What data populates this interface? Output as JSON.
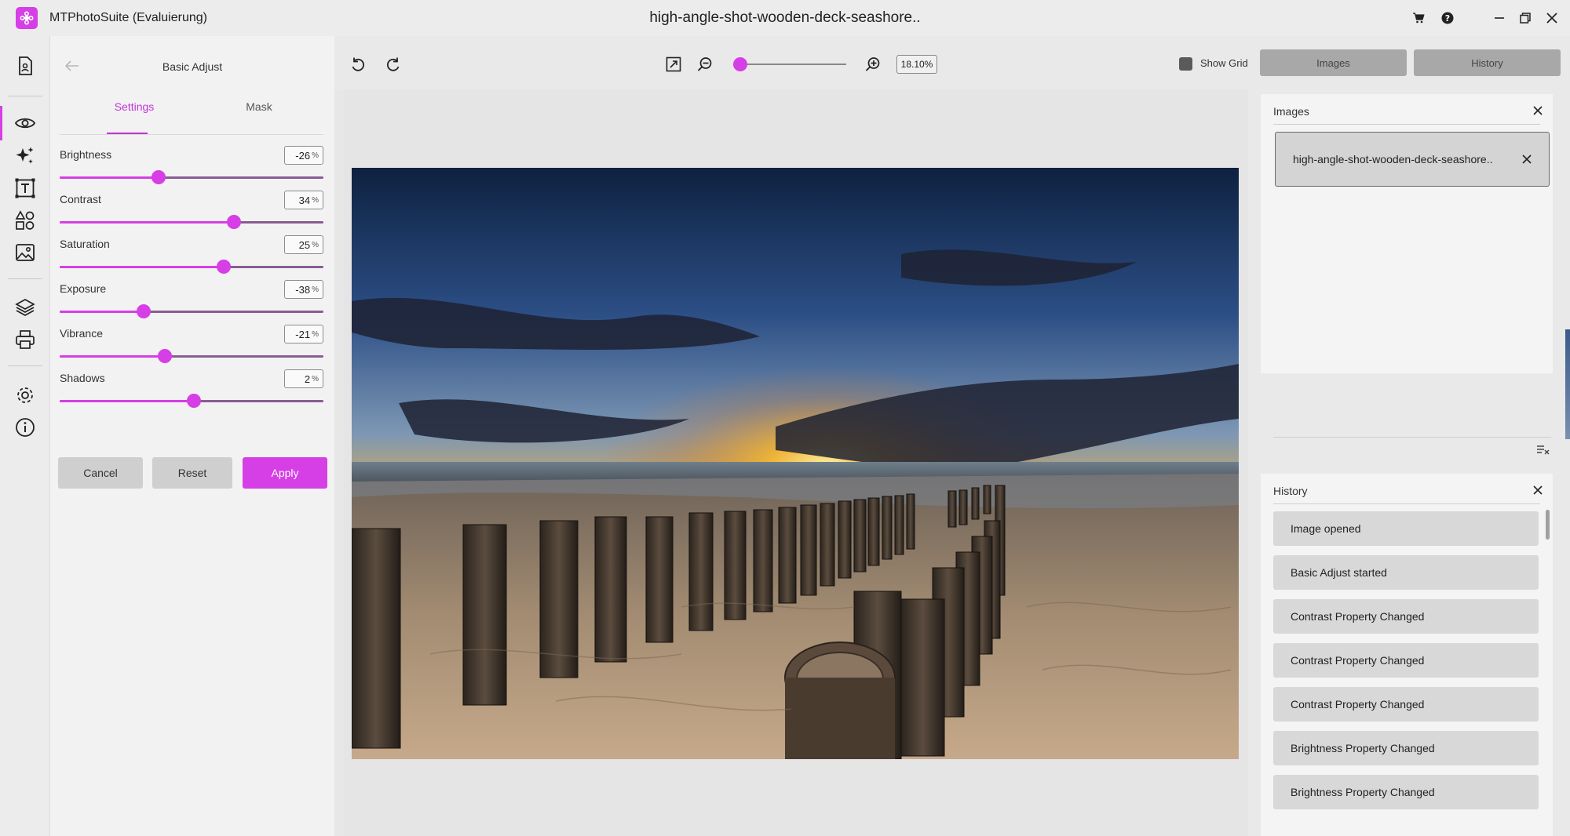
{
  "app": {
    "title": "MTPhotoSuite (Evaluierung)",
    "document_title": "high-angle-shot-wooden-deck-seashore.."
  },
  "panel": {
    "title": "Basic Adjust",
    "tabs": [
      {
        "label": "Settings"
      },
      {
        "label": "Mask"
      }
    ],
    "sliders": [
      {
        "label": "Brightness",
        "value": "-26",
        "unit": "%",
        "position": 0.374
      },
      {
        "label": "Contrast",
        "value": "34",
        "unit": "%",
        "position": 0.66
      },
      {
        "label": "Saturation",
        "value": "25",
        "unit": "%",
        "position": 0.621
      },
      {
        "label": "Exposure",
        "value": "-38",
        "unit": "%",
        "position": 0.318
      },
      {
        "label": "Vibrance",
        "value": "-21",
        "unit": "%",
        "position": 0.4
      },
      {
        "label": "Shadows",
        "value": "2",
        "unit": "%",
        "position": 0.508
      }
    ],
    "buttons": {
      "cancel": "Cancel",
      "reset": "Reset",
      "apply": "Apply"
    }
  },
  "toolbar": {
    "zoom_value": "18.10%",
    "zoom_position": 0.05,
    "show_grid_label": "Show Grid",
    "show_grid_checked": true,
    "images_button": "Images",
    "history_button": "History"
  },
  "images_panel": {
    "title": "Images",
    "items": [
      {
        "label": "high-angle-shot-wooden-deck-seashore.."
      }
    ]
  },
  "history_panel": {
    "title": "History",
    "items": [
      {
        "label": "Image opened"
      },
      {
        "label": "Basic Adjust started"
      },
      {
        "label": "Contrast Property Changed"
      },
      {
        "label": "Contrast Property Changed"
      },
      {
        "label": "Contrast Property Changed"
      },
      {
        "label": "Brightness Property Changed"
      },
      {
        "label": "Brightness Property Changed"
      }
    ]
  },
  "colors": {
    "accent": "#d63ee6",
    "track": "#8a5c93"
  }
}
